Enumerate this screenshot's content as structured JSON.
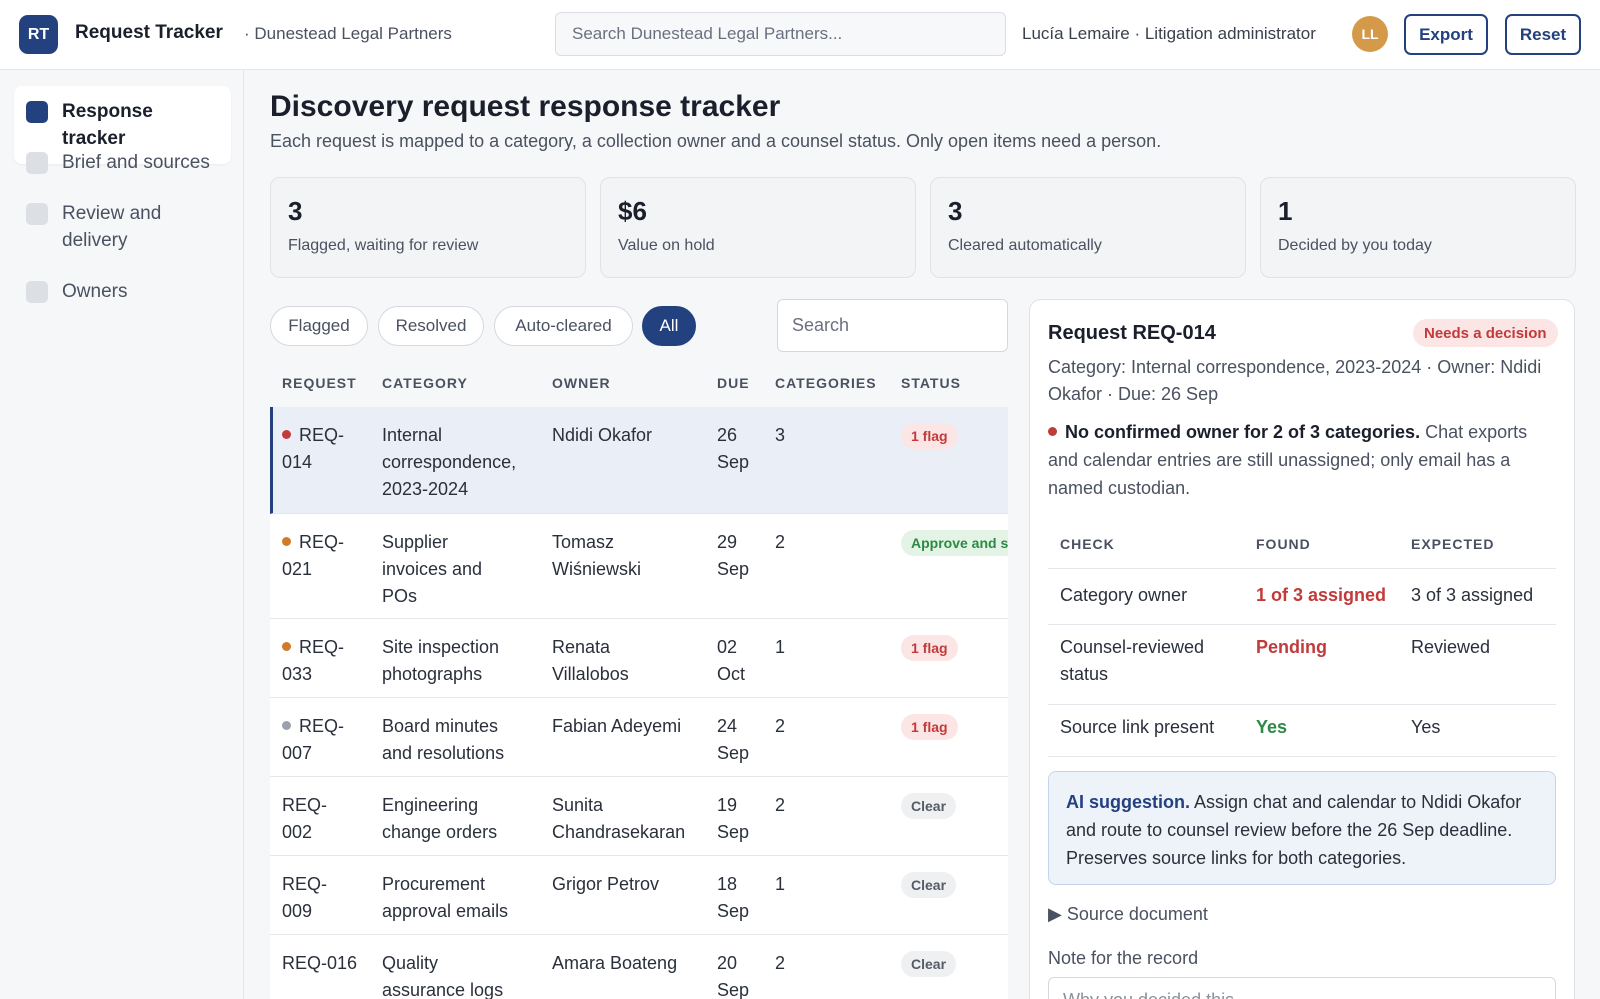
{
  "header": {
    "logo": "RT",
    "title": "Request Tracker",
    "org": "· Dunestead Legal Partners",
    "search_placeholder": "Search Dunestead Legal Partners...",
    "user": "Lucía Lemaire · Litigation administrator",
    "avatar": "LL",
    "export_label": "Export",
    "reset_label": "Reset"
  },
  "sidebar": {
    "items": [
      {
        "label": "Response tracker",
        "active": true
      },
      {
        "label": "Brief and sources"
      },
      {
        "label": "Review and delivery"
      },
      {
        "label": "Owners"
      }
    ]
  },
  "main": {
    "title": "Discovery request response tracker",
    "subtitle": "Each request is mapped to a category, a collection owner and a counsel status. Only open items need a person.",
    "stats": [
      {
        "value": "3",
        "label": "Flagged, waiting for review"
      },
      {
        "value": "$6",
        "label": "Value on hold"
      },
      {
        "value": "3",
        "label": "Cleared automatically"
      },
      {
        "value": "1",
        "label": "Decided by you today"
      }
    ],
    "filters": [
      "Flagged",
      "Resolved",
      "Auto-cleared",
      "All"
    ],
    "search_placeholder": "Search",
    "columns": [
      "REQUEST",
      "CATEGORY",
      "OWNER",
      "DUE",
      "CATEGORIES",
      "STATUS"
    ],
    "rows": [
      {
        "id": "REQ-\n014",
        "dot": "#c23a3a",
        "category": "Internal\ncorrespondence,\n2023-2024",
        "owner": "Ndidi Okafor",
        "due": "26\nSep",
        "count": "3",
        "status": "1 flag",
        "status_type": "flag",
        "selected": true
      },
      {
        "id": "REQ-\n021",
        "dot": "#d07a2a",
        "category": "Supplier\ninvoices and\nPOs",
        "owner": "Tomasz\nWiśniewski",
        "due": "29\nSep",
        "count": "2",
        "status": "Approve and send",
        "status_type": "approve"
      },
      {
        "id": "REQ-\n033",
        "dot": "#d07a2a",
        "category": "Site inspection\nphotographs",
        "owner": "Renata\nVillalobos",
        "due": "02\nOct",
        "count": "1",
        "status": "1 flag",
        "status_type": "flag"
      },
      {
        "id": "REQ-\n007",
        "dot": "#9aa0ac",
        "category": "Board minutes\nand resolutions",
        "owner": "Fabian Adeyemi",
        "due": "24\nSep",
        "count": "2",
        "status": "1 flag",
        "status_type": "flag"
      },
      {
        "id": "REQ-\n002",
        "dot": "",
        "category": "Engineering\nchange orders",
        "owner": "Sunita\nChandrasekaran",
        "due": "19\nSep",
        "count": "2",
        "status": "Clear",
        "status_type": "clear"
      },
      {
        "id": "REQ-\n009",
        "dot": "",
        "category": "Procurement\napproval emails",
        "owner": "Grigor Petrov",
        "due": "18\nSep",
        "count": "1",
        "status": "Clear",
        "status_type": "clear"
      },
      {
        "id": "REQ-016",
        "dot": "",
        "category": "Quality\nassurance logs",
        "owner": "Amara Boateng",
        "due": "20\nSep",
        "count": "2",
        "status": "Clear",
        "status_type": "clear"
      }
    ]
  },
  "panel": {
    "title": "Request REQ-014",
    "badge": "Needs a decision",
    "meta": "Category: Internal correspondence, 2023-2024 · Owner: Ndidi Okafor · Due: 26 Sep",
    "issue_bold": "No confirmed owner for 2 of 3 categories.",
    "issue_text": " Chat exports and calendar entries are still unassigned; only email has a named custodian.",
    "check_columns": [
      "CHECK",
      "FOUND",
      "EXPECTED"
    ],
    "checks": [
      {
        "check": "Category owner",
        "found": "1 of 3 assigned",
        "expected": "3 of 3 assigned",
        "found_state": "bad"
      },
      {
        "check": "Counsel-reviewed status",
        "found": "Pending",
        "expected": "Reviewed",
        "found_state": "bad"
      },
      {
        "check": "Source link present",
        "found": "Yes",
        "expected": "Yes",
        "found_state": "good"
      }
    ],
    "ai_label": "AI suggestion.",
    "ai_text": " Assign chat and calendar to Ndidi Okafor and route to counsel review before the 26 Sep deadline. Preserves source links for both categories.",
    "source_doc": "▶  Source document",
    "note_label": "Note for the record",
    "note_placeholder": "Why you decided this"
  }
}
